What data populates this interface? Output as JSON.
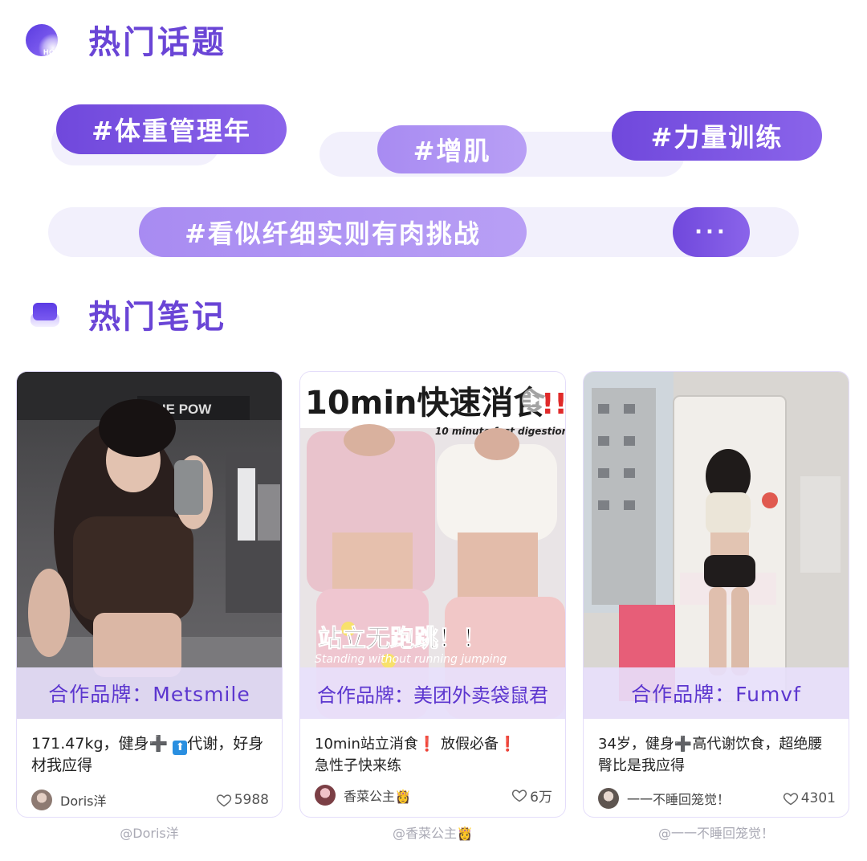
{
  "topics_section": {
    "title": "热门话题",
    "icon_text": "HOT",
    "tags": [
      "#体重管理年",
      "#增肌",
      "#力量训练",
      "#看似纤细实则有肉挑战"
    ],
    "more_label": "···"
  },
  "notes_section": {
    "title": "热门笔记",
    "cards": [
      {
        "brand": "合作品牌：Metsmile",
        "desc_a": "171.47kg，健身",
        "plus": "➕",
        "up": "⬆",
        "desc_b": "代谢，好身材我应得",
        "author": "Doris洋",
        "likes": "5988",
        "credit": "@Doris洋",
        "photo_text": "THE POW"
      },
      {
        "brand": "合作品牌：美团外卖袋鼠君",
        "desc_a": "10min站立消食",
        "bang1": "❗",
        "desc_b": "放假必备",
        "bang2": "❗",
        "desc_c": "急性子快来练",
        "author": "香菜公主👸",
        "likes": "6万",
        "credit": "@香菜公主👸",
        "photo_title": "10min快速消食",
        "photo_title_bangs": "!!",
        "photo_subtitle": "10 minute fast digestion",
        "photo_caption": "站立无跑跳！！",
        "photo_caption_en": "Standing without running jumping"
      },
      {
        "brand": "合作品牌：Fumvf",
        "desc_a": "34岁，健身",
        "plus": "➕",
        "desc_b": "高代谢饮食，超绝腰臀比是我应得",
        "author": "一一不睡回笼觉！",
        "likes": "4301",
        "credit": "@一一不睡回笼觉！"
      }
    ]
  },
  "colors": {
    "accent": "#6a45d6",
    "tag_dark": "#7048dc",
    "tag_light": "#b39af4",
    "track": "#f2f0fc",
    "brand_bar": "#e8e0fc"
  }
}
